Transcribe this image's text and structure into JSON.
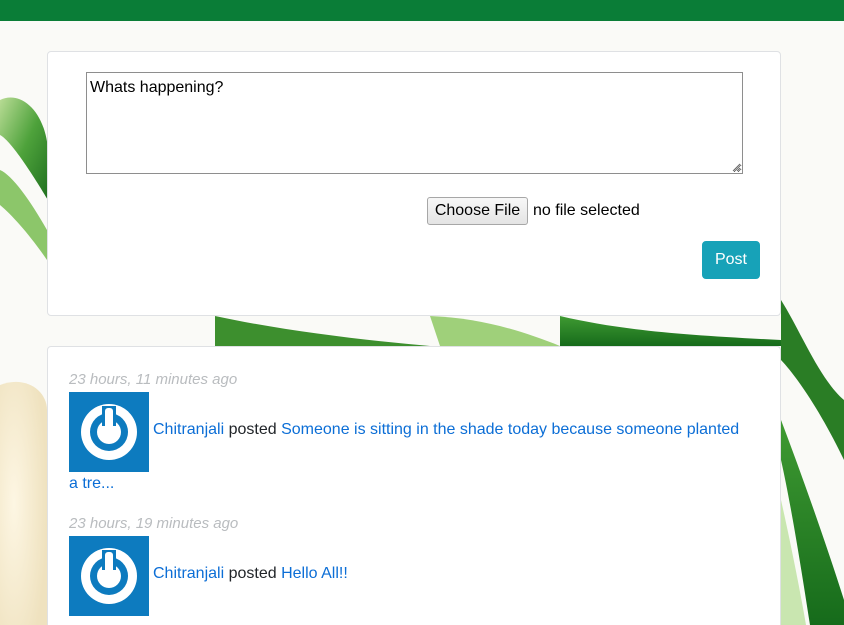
{
  "compose": {
    "text_value": "Whats happening?",
    "file_button_label": "Choose File",
    "file_status": "no file selected",
    "post_label": "Post"
  },
  "feed": {
    "posts": [
      {
        "time": "23 hours, 11 minutes ago",
        "author": "Chitranjali",
        "verb": "posted",
        "content_line1": "Someone is sitting in the shade today because someone planted",
        "content_line2": "a tre..."
      },
      {
        "time": "23 hours, 19 minutes ago",
        "author": "Chitranjali",
        "verb": "posted",
        "content_line1": "Hello All!!"
      }
    ]
  },
  "colors": {
    "topbar": "#0a7d37",
    "post_button": "#17a2b8",
    "link": "#0c6ed6",
    "avatar_bg": "#0d7bbf",
    "timestamp": "#b9bcbf"
  },
  "icons": {
    "avatar": "power-icon"
  }
}
